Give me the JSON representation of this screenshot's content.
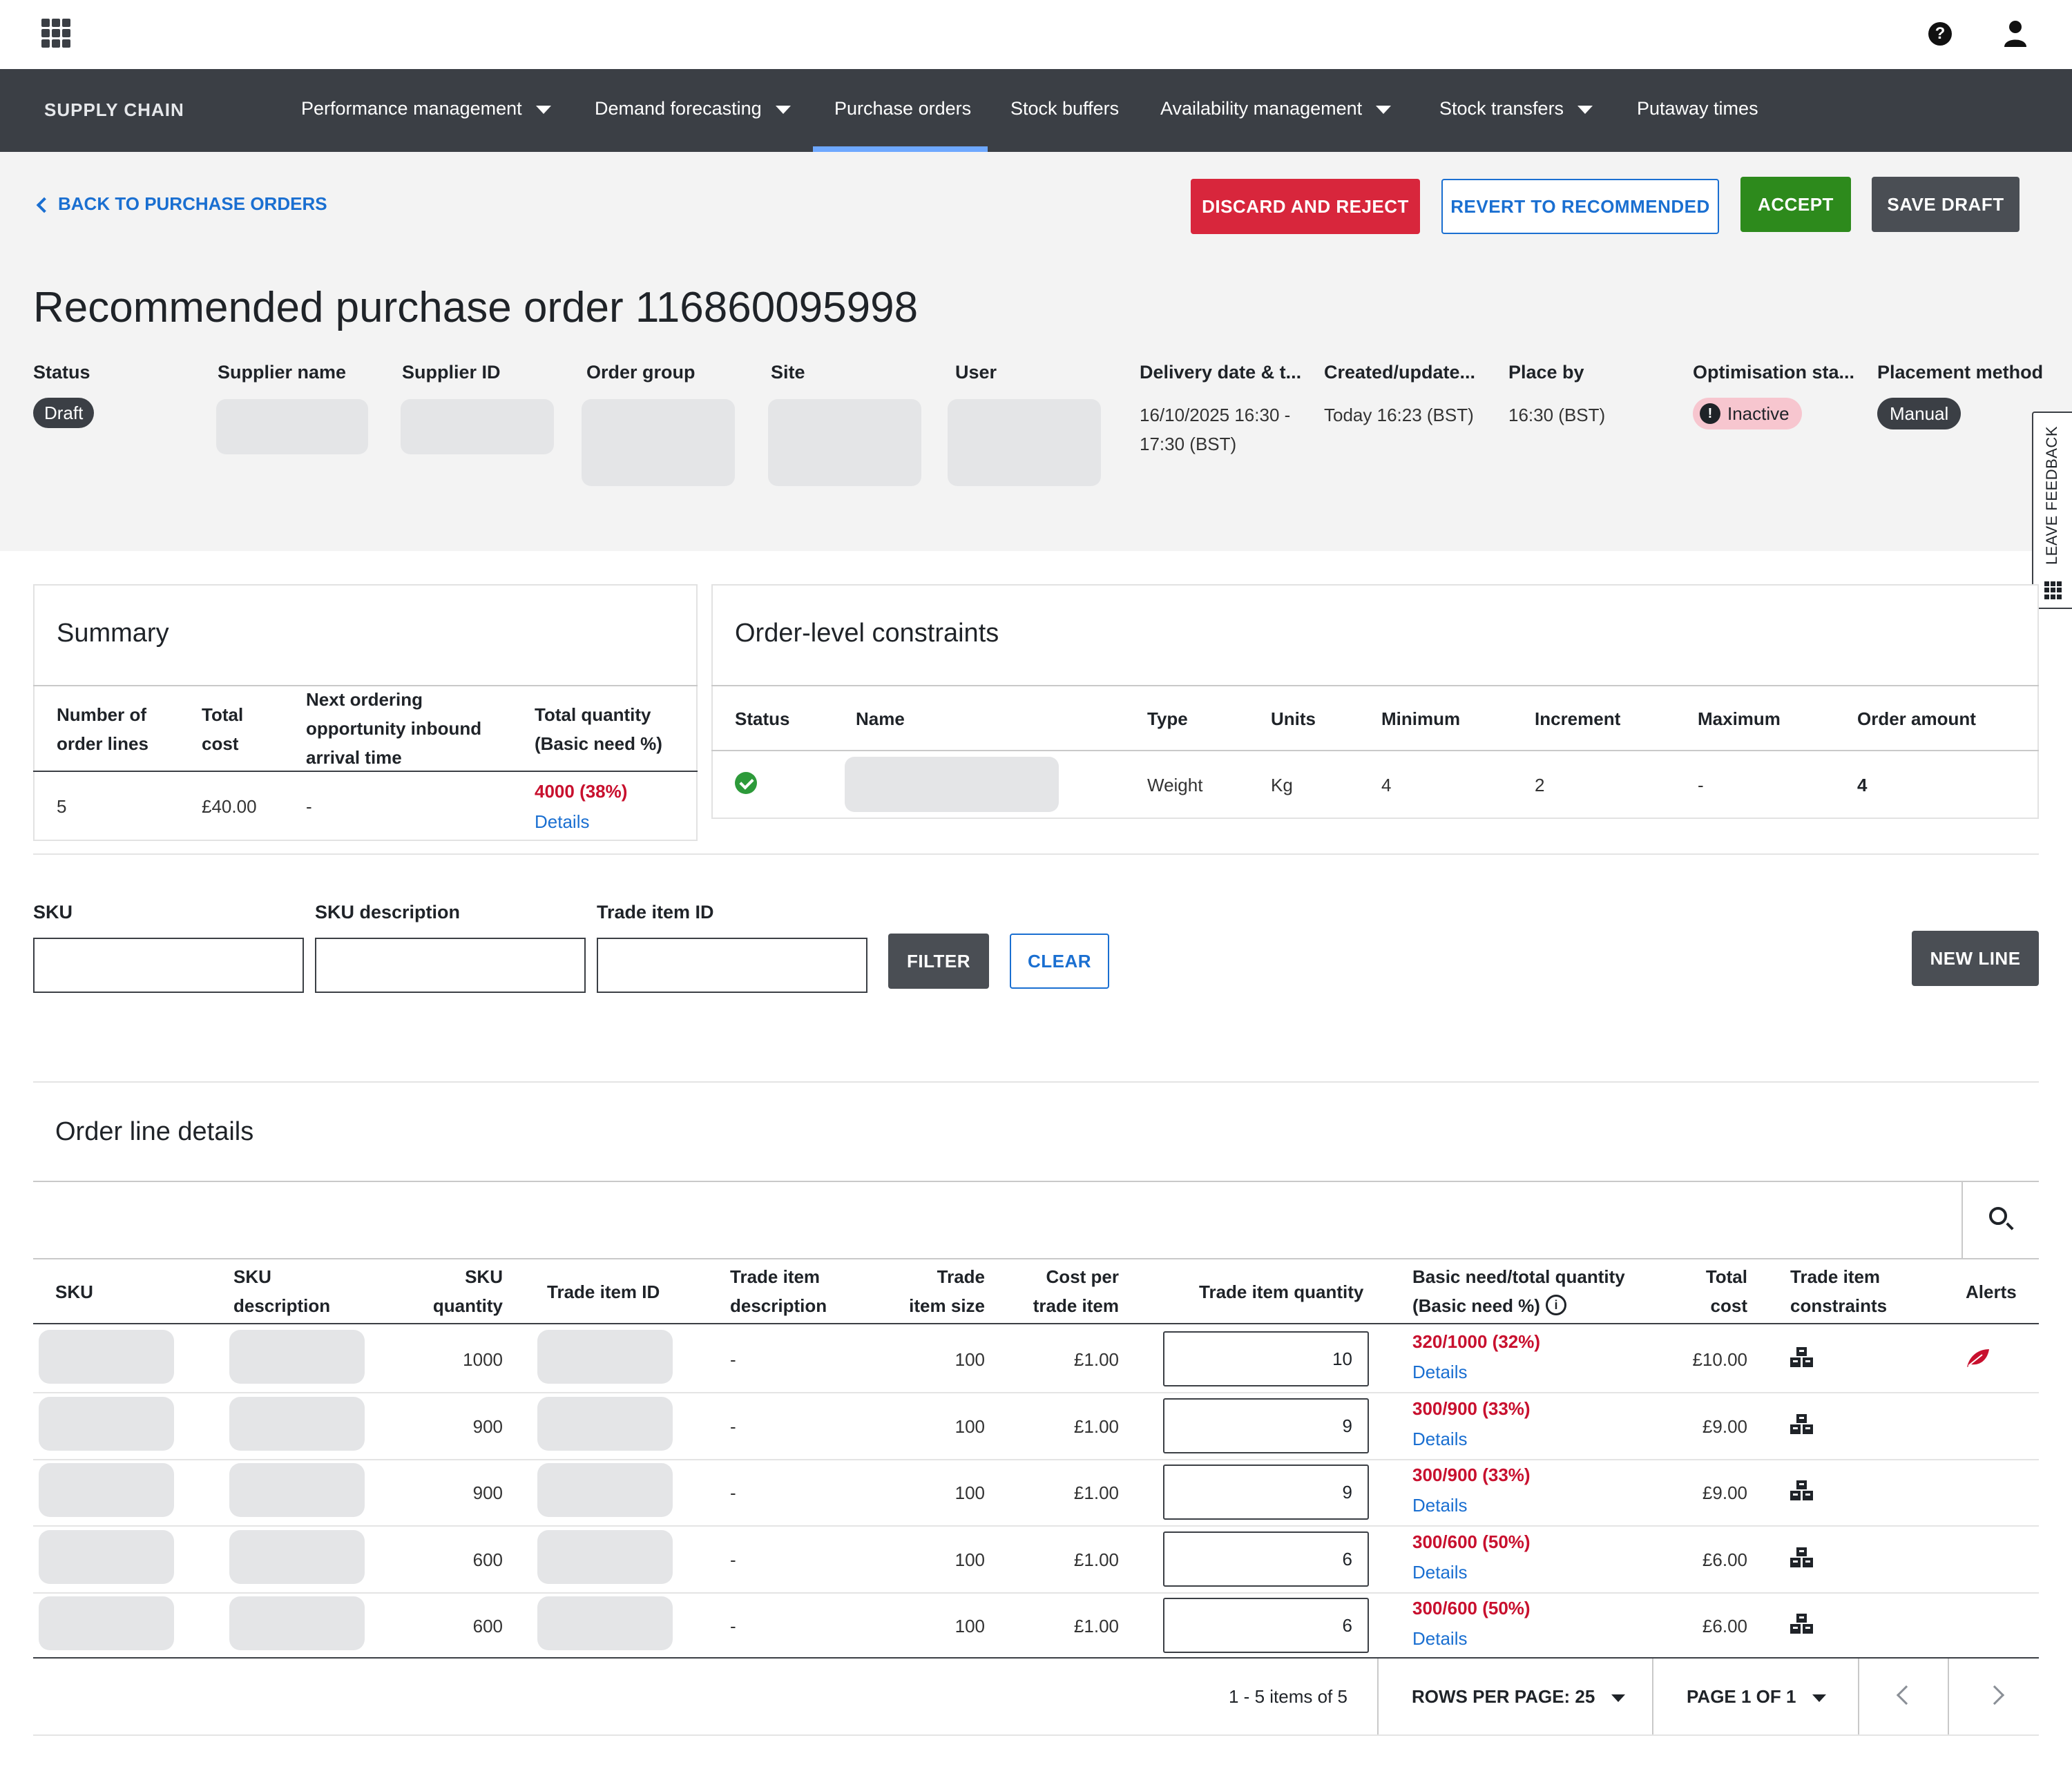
{
  "nav": {
    "brand": "SUPPLY CHAIN",
    "items": [
      {
        "label": "Performance management",
        "dropdown": true
      },
      {
        "label": "Demand forecasting",
        "dropdown": true
      },
      {
        "label": "Purchase orders",
        "dropdown": false,
        "active": true
      },
      {
        "label": "Stock buffers",
        "dropdown": false
      },
      {
        "label": "Availability management",
        "dropdown": true
      },
      {
        "label": "Stock transfers",
        "dropdown": true
      },
      {
        "label": "Putaway times",
        "dropdown": false
      }
    ]
  },
  "header": {
    "back_label": "BACK TO PURCHASE ORDERS",
    "actions": {
      "discard": "DISCARD AND REJECT",
      "revert": "REVERT TO RECOMMENDED",
      "accept": "ACCEPT",
      "save": "SAVE DRAFT"
    },
    "title": "Recommended purchase order 116860095998",
    "fields": {
      "status_label": "Status",
      "status_value": "Draft",
      "supplier_name_label": "Supplier name",
      "supplier_id_label": "Supplier ID",
      "order_group_label": "Order group",
      "site_label": "Site",
      "user_label": "User",
      "delivery_label": "Delivery date & t...",
      "delivery_value_1": "16/10/2025 16:30 -",
      "delivery_value_2": "17:30 (BST)",
      "created_label": "Created/update...",
      "created_value": "Today 16:23 (BST)",
      "place_by_label": "Place by",
      "place_by_value": "16:30 (BST)",
      "optimisation_label": "Optimisation sta...",
      "optimisation_value": "Inactive",
      "placement_label": "Placement method",
      "placement_value": "Manual"
    },
    "feedback_label": "LEAVE FEEDBACK"
  },
  "summary": {
    "title": "Summary",
    "headers": {
      "order_lines_1": "Number of",
      "order_lines_2": "order lines",
      "total_cost_1": "Total",
      "total_cost_2": "cost",
      "next_1": "Next ordering",
      "next_2": "opportunity inbound",
      "next_3": "arrival time",
      "total_qty_1": "Total quantity",
      "total_qty_2": "(Basic need %)"
    },
    "row": {
      "order_lines": "5",
      "total_cost": "£40.00",
      "next": "-",
      "total_qty": "4000  (38%)",
      "details": "Details"
    }
  },
  "constraints": {
    "title": "Order-level constraints",
    "headers": {
      "status": "Status",
      "name": "Name",
      "type": "Type",
      "units": "Units",
      "minimum": "Minimum",
      "increment": "Increment",
      "maximum": "Maximum",
      "order_amount": "Order amount"
    },
    "row": {
      "type": "Weight",
      "units": "Kg",
      "minimum": "4",
      "increment": "2",
      "maximum": "-",
      "order_amount": "4"
    }
  },
  "filter": {
    "sku_label": "SKU",
    "sku_desc_label": "SKU description",
    "trade_item_label": "Trade item ID",
    "filter_button": "FILTER",
    "clear_button": "CLEAR",
    "new_line_button": "NEW LINE"
  },
  "order_lines": {
    "title": "Order line details",
    "headers": {
      "sku": "SKU",
      "sku_desc_1": "SKU",
      "sku_desc_2": "description",
      "sku_qty_1": "SKU",
      "sku_qty_2": "quantity",
      "trade_item_id": "Trade item ID",
      "trade_desc_1": "Trade item",
      "trade_desc_2": "description",
      "trade_size_1": "Trade",
      "trade_size_2": "item size",
      "cost_per_1": "Cost per",
      "cost_per_2": "trade item",
      "trade_qty": "Trade item quantity",
      "basic_need_1": "Basic need/total quantity",
      "basic_need_2": "(Basic need %)",
      "total_cost_1": "Total",
      "total_cost_2": "cost",
      "constraints_1": "Trade item",
      "constraints_2": "constraints",
      "alerts": "Alerts"
    },
    "rows": [
      {
        "sku_qty": "1000",
        "trade_desc": "-",
        "trade_size": "100",
        "cost_per": "£1.00",
        "trade_qty": "10",
        "basic_need": "320/1000  (32%)",
        "details": "Details",
        "total_cost": "£10.00",
        "alert": true
      },
      {
        "sku_qty": "900",
        "trade_desc": "-",
        "trade_size": "100",
        "cost_per": "£1.00",
        "trade_qty": "9",
        "basic_need": "300/900  (33%)",
        "details": "Details",
        "total_cost": "£9.00",
        "alert": false
      },
      {
        "sku_qty": "900",
        "trade_desc": "-",
        "trade_size": "100",
        "cost_per": "£1.00",
        "trade_qty": "9",
        "basic_need": "300/900  (33%)",
        "details": "Details",
        "total_cost": "£9.00",
        "alert": false
      },
      {
        "sku_qty": "600",
        "trade_desc": "-",
        "trade_size": "100",
        "cost_per": "£1.00",
        "trade_qty": "6",
        "basic_need": "300/600  (50%)",
        "details": "Details",
        "total_cost": "£6.00",
        "alert": false
      },
      {
        "sku_qty": "600",
        "trade_desc": "-",
        "trade_size": "100",
        "cost_per": "£1.00",
        "trade_qty": "6",
        "basic_need": "300/600  (50%)",
        "details": "Details",
        "total_cost": "£6.00",
        "alert": false
      }
    ]
  },
  "pagination": {
    "items_text": "1 - 5 items of 5",
    "rows_per_page": "ROWS PER PAGE: 25",
    "page_text": "PAGE 1 OF 1"
  },
  "colors": {
    "nav_bg": "#3b3f45",
    "accent": "#1a6fd1",
    "danger": "#d8263c",
    "success": "#2d8a1c"
  }
}
